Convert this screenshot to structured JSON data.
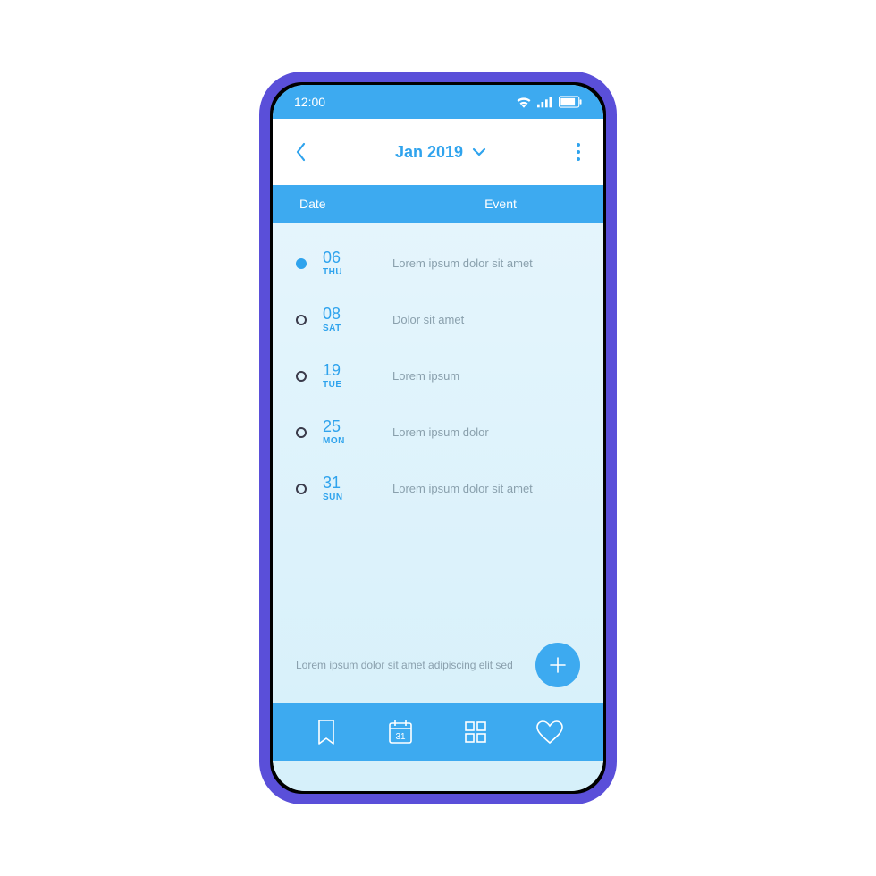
{
  "status": {
    "time": "12:00"
  },
  "header": {
    "title": "Jan 2019"
  },
  "columns": {
    "date": "Date",
    "event": "Event"
  },
  "events": [
    {
      "day": "06",
      "dow": "THU",
      "text": "Lorem ipsum dolor sit amet",
      "active": true
    },
    {
      "day": "08",
      "dow": "SAT",
      "text": "Dolor sit amet",
      "active": false
    },
    {
      "day": "19",
      "dow": "TUE",
      "text": "Lorem ipsum",
      "active": false
    },
    {
      "day": "25",
      "dow": "MON",
      "text": "Lorem ipsum dolor",
      "active": false
    },
    {
      "day": "31",
      "dow": "SUN",
      "text": "Lorem ipsum dolor sit amet",
      "active": false
    }
  ],
  "note": "Lorem ipsum dolor sit amet adipiscing elit sed",
  "colors": {
    "accent": "#3daaf0",
    "frame": "#5a4fd9"
  },
  "nav": {
    "calendar_day": "31"
  }
}
